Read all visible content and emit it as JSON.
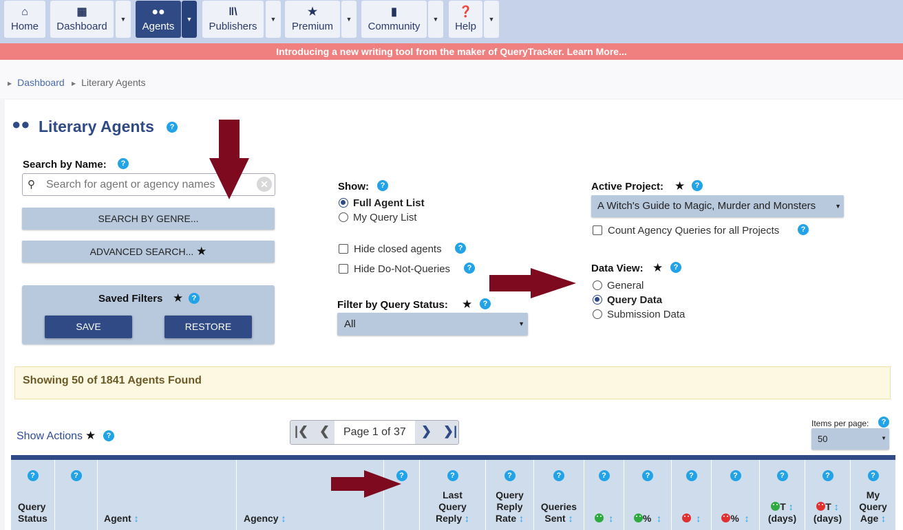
{
  "nav": {
    "items": [
      {
        "label": "Home",
        "icon": "home-icon"
      },
      {
        "label": "Dashboard",
        "icon": "grid-icon"
      },
      {
        "label": "Agents",
        "icon": "users-icon"
      },
      {
        "label": "Publishers",
        "icon": "books-icon"
      },
      {
        "label": "Premium",
        "icon": "star-icon"
      },
      {
        "label": "Community",
        "icon": "chat-icon"
      },
      {
        "label": "Help",
        "icon": "question-icon"
      }
    ]
  },
  "banner": {
    "text": "Introducing a new writing tool from the maker of QueryTracker. Learn More..."
  },
  "breadcrumb": {
    "items": [
      "Dashboard",
      "Literary Agents"
    ]
  },
  "page": {
    "title": "Literary Agents"
  },
  "search": {
    "label": "Search by Name:",
    "placeholder": "Search for agent or agency names",
    "genre_button": "SEARCH BY GENRE...",
    "advanced_button": "ADVANCED SEARCH..."
  },
  "saved_filters": {
    "label": "Saved Filters",
    "save": "SAVE",
    "restore": "RESTORE"
  },
  "show": {
    "label": "Show:",
    "options": [
      "Full Agent List",
      "My Query List"
    ],
    "selected": "Full Agent List",
    "hide_closed": "Hide closed agents",
    "hide_dnq": "Hide Do-Not-Queries"
  },
  "filter_status": {
    "label": "Filter by Query Status:",
    "value": "All"
  },
  "active_project": {
    "label": "Active Project:",
    "value": "A Witch's Guide to Magic, Murder and Monsters",
    "count_agency": "Count Agency Queries for all Projects"
  },
  "data_view": {
    "label": "Data View:",
    "options": [
      "General",
      "Query Data",
      "Submission Data"
    ],
    "selected": "Query Data"
  },
  "results": {
    "text": "Showing 50 of 1841 Agents Found"
  },
  "actions": {
    "label": "Show Actions"
  },
  "pager": {
    "text": "Page 1 of 37"
  },
  "items_per_page": {
    "label": "Items per page:",
    "value": "50"
  },
  "table": {
    "headers": [
      {
        "lines": [
          "Query",
          "Status"
        ]
      },
      {
        "lines": []
      },
      {
        "lines": [
          "Agent"
        ]
      },
      {
        "lines": [
          "Agency"
        ]
      },
      {
        "lines": []
      },
      {
        "lines": [
          "Last",
          "Query",
          "Reply"
        ]
      },
      {
        "lines": [
          "Query",
          "Reply",
          "Rate"
        ]
      },
      {
        "lines": [
          "Queries",
          "Sent"
        ]
      },
      {
        "lines": [
          ""
        ]
      },
      {
        "lines": [
          "%"
        ]
      },
      {
        "lines": [
          ""
        ]
      },
      {
        "lines": [
          "%"
        ]
      },
      {
        "lines": [
          "T",
          "(days)"
        ]
      },
      {
        "lines": [
          "T",
          "(days)"
        ]
      },
      {
        "lines": [
          "My",
          "Query",
          "Age"
        ]
      }
    ]
  },
  "colors": {
    "nav_bg": "#c5d2ea",
    "accent": "#2f4a85",
    "banner": "#f08080",
    "help": "#22a3e8",
    "annotation_arrow": "#7d0a1e"
  }
}
